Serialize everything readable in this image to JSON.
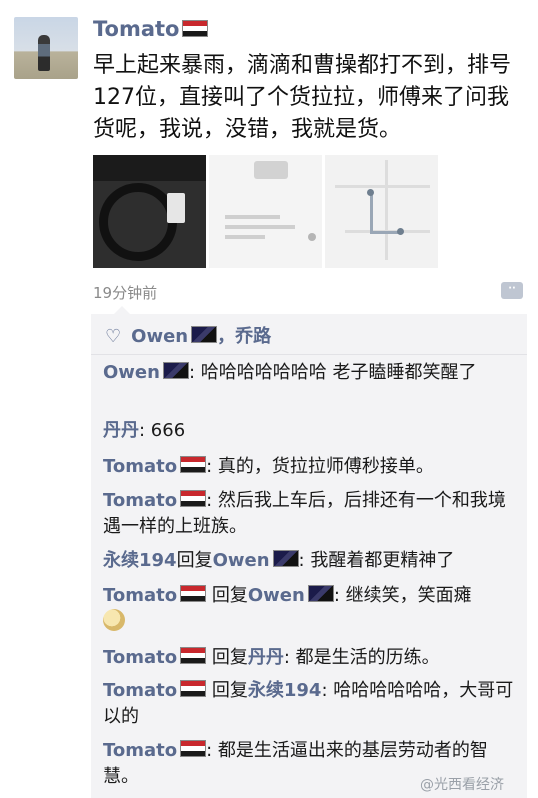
{
  "post": {
    "username": "Tomato",
    "text": "早上起来暴雨，滴滴和曹操都打不到，排号127位，直接叫了个货拉拉，师傅来了问我货呢，我说，没错，我就是货。",
    "time": "19分钟前",
    "more_icon": "··"
  },
  "likes": {
    "names": "Owen",
    "extra": "，乔路",
    "heart_icon": "♡"
  },
  "comments": [
    {
      "name": "Owen",
      "text": ": 哈哈哈哈哈哈哈 老子瞌睡都笑醒了"
    },
    {
      "name": "丹丹",
      "text": ": 666"
    },
    {
      "name": "Tomato",
      "text": ": 真的，货拉拉师傅秒接单。"
    },
    {
      "name": "Tomato",
      "text": ": 然后我上车后，后排还有一个和我境遇一样的上班族。"
    },
    {
      "name": "永续194",
      "reply_word": "回复",
      "reply_to": "Owen",
      "text": ": 我醒着都更精神了"
    },
    {
      "name": "Tomato",
      "reply_word": " 回复",
      "reply_to": "Owen",
      "text": ": 继续笑，笑面瘫"
    },
    {
      "name": "Tomato",
      "reply_word": " 回复",
      "reply_to": "丹丹",
      "text": ": 都是生活的历练。"
    },
    {
      "name": "Tomato",
      "reply_word": " 回复",
      "reply_to": "永续194",
      "text": ": 哈哈哈哈哈哈，大哥可以的"
    },
    {
      "name": "Tomato",
      "text": ": 都是生活逼出来的基层劳动者的智慧。"
    }
  ],
  "watermark": "@光西看经济"
}
